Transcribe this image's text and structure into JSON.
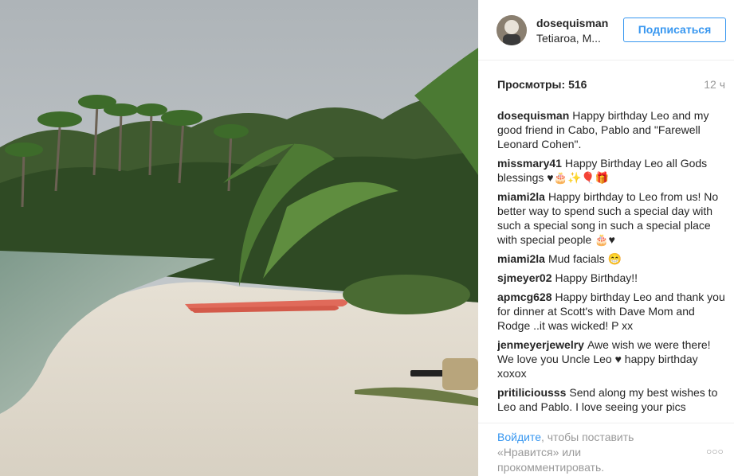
{
  "header": {
    "username": "dosequisman",
    "location": "Tetiaroa, M...",
    "follow_label": "Подписаться"
  },
  "stats": {
    "views_label": "Просмотры:",
    "views_count": "516",
    "time_ago": "12 ч"
  },
  "comments": [
    {
      "user": "dosequisman",
      "text": "Happy birthday Leo and my good friend in Cabo, Pablo and \"Farewell Leonard Cohen\"."
    },
    {
      "user": "missmary41",
      "text": "Happy Birthday Leo all Gods blessings ♥🎂✨🎈🎁"
    },
    {
      "user": "miami2la",
      "text": "Happy birthday to Leo from us! No better way to spend such a special day with such a special song in such a special place with special people 🎂♥"
    },
    {
      "user": "miami2la",
      "text": "Mud facials 😁"
    },
    {
      "user": "sjmeyer02",
      "text": "Happy Birthday!!"
    },
    {
      "user": "apmcg628",
      "text": "Happy birthday Leo and thank you for dinner at Scott's with Dave Mom and Rodge ..it was wicked! P xx"
    },
    {
      "user": "jenmeyerjewelry",
      "text": "Awe wish we were there! We love you Uncle Leo ♥ happy birthday xoxox"
    },
    {
      "user": "pritiliciousss",
      "text": "Send along my best wishes to Leo and Pablo. I love seeing your pics"
    }
  ],
  "footer": {
    "login_link": "Войдите",
    "login_text": ", чтобы поставить «Нравится» или прокомментировать.",
    "more_dots": "○○○"
  }
}
